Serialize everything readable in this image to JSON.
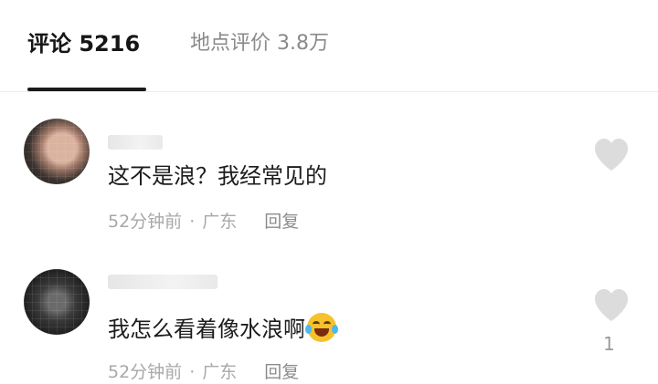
{
  "tabs": {
    "comments_label": "评论 5216",
    "place_reviews_label": "地点评价 3.8万"
  },
  "comments": [
    {
      "text": "这不是浪？我经常见的",
      "time": "52分钟前",
      "separator": "·",
      "location": "广东",
      "reply_label": "回复",
      "like_count": ""
    },
    {
      "text": "我怎么看着像水浪啊",
      "emoji": "laughing-crying-emoji",
      "time": "52分钟前",
      "separator": "·",
      "location": "广东",
      "reply_label": "回复",
      "like_count": "1"
    }
  ],
  "colors": {
    "heart": "#dcdcdc",
    "primary_text": "#1c1c1c",
    "secondary_text": "#a8a8a8"
  }
}
